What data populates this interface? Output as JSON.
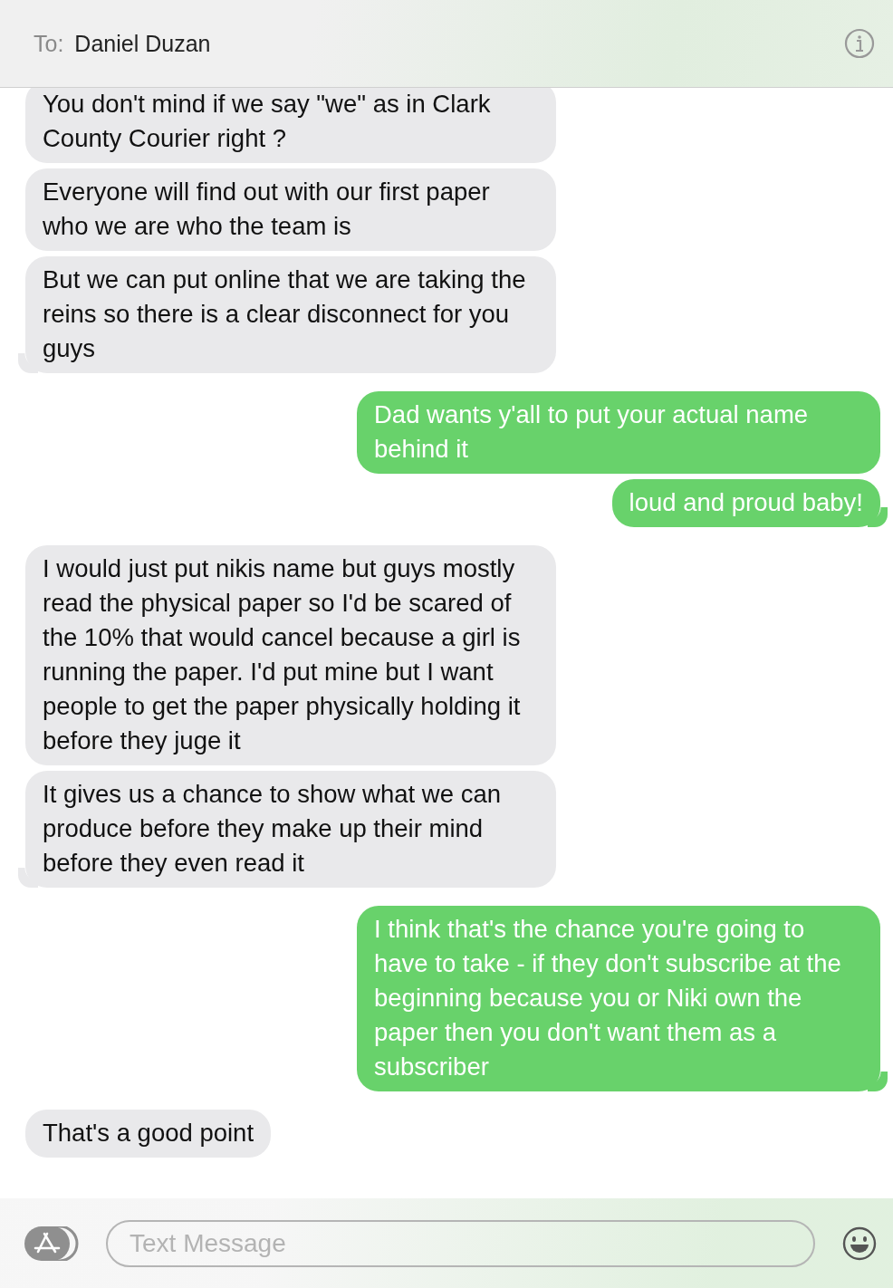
{
  "header": {
    "to_label": "To:",
    "recipient": "Daniel Duzan"
  },
  "messages": [
    {
      "kind": "received",
      "text": "You don't mind if we say \"we\" as in Clark County Courier right ?",
      "tail": false
    },
    {
      "kind": "received",
      "text": "Everyone will find out with our first paper who we are who the team is",
      "tail": false
    },
    {
      "kind": "received",
      "text": "But we can put online that we are taking the reins so there is a clear disconnect for you guys",
      "tail": true
    },
    {
      "kind": "sent",
      "text": "Dad wants y'all to put your actual name behind it",
      "tail": false
    },
    {
      "kind": "sent",
      "text": "loud and proud baby!",
      "tail": true
    },
    {
      "kind": "received",
      "text": "I would just put nikis name but guys mostly read the physical paper so I'd be scared of the 10% that would cancel because a girl is running the paper.  I'd put mine but I want people to get the paper physically holding it before they juge it",
      "tail": false
    },
    {
      "kind": "received",
      "text": "It gives us a chance to show what we can produce before they make up their mind before they even read it",
      "tail": true
    },
    {
      "kind": "sent",
      "text": "I think that's the chance you're going to have to take - if they don't subscribe at the beginning because you or Niki own the paper then you don't want them as a subscriber",
      "tail": true
    },
    {
      "kind": "received",
      "text": "That's a good point",
      "tail": false
    }
  ],
  "composer": {
    "placeholder": "Text Message"
  }
}
